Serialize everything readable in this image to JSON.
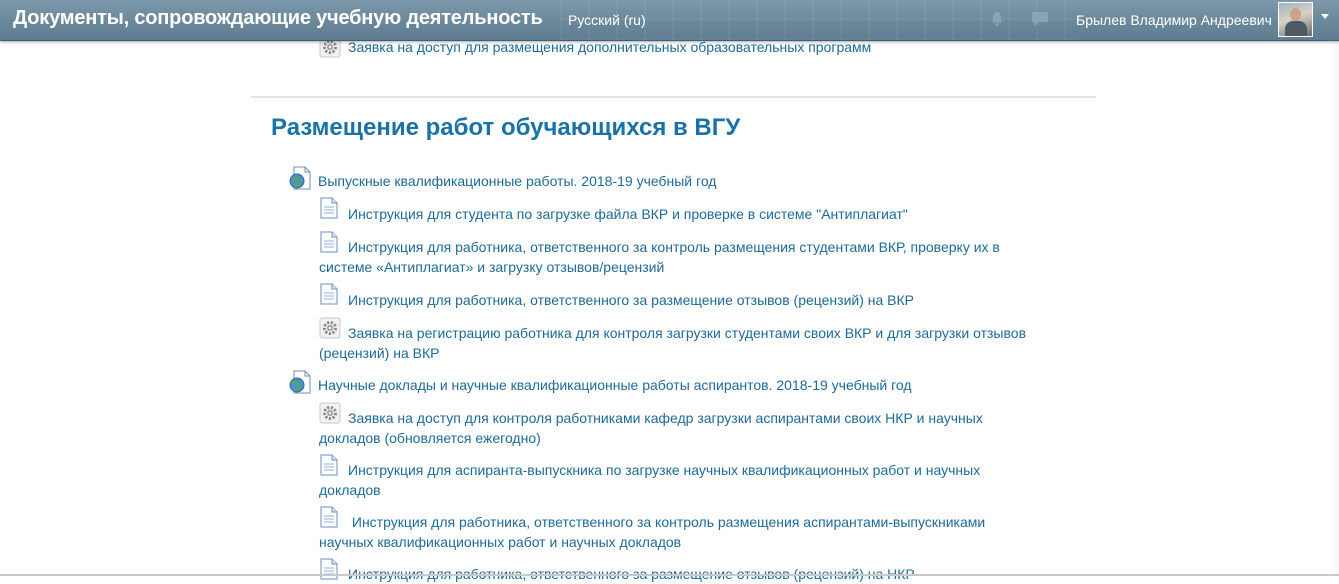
{
  "header": {
    "site_title": "Документы, сопровождающие учебную деятельность",
    "language": "Русский (ru)",
    "user_name": "Брылев Владимир Андреевич"
  },
  "top_item": {
    "label": "Заявка на доступ для размещения дополнительных образовательных программ"
  },
  "section": {
    "title": "Размещение работ обучающихся в ВГУ",
    "groups": [
      {
        "label": "Выпускные квалификационные работы. 2018-19 учебный год",
        "items": [
          {
            "icon": "document-icon",
            "line1": "Инструкция для студента по загрузке файла ВКР и проверке в системе \"Антиплагиат\"",
            "line2": ""
          },
          {
            "icon": "document-icon",
            "line1": "Инструкция для работника, ответственного за контроль размещения студентами ВКР, проверку их в",
            "line2": "системе «Антиплагиат» и загрузку отзывов/рецензий"
          },
          {
            "icon": "document-icon",
            "line1": "Инструкция для работника, ответственного за размещение отзывов (рецензий) на ВКР",
            "line2": ""
          },
          {
            "icon": "gear-icon",
            "line1": "Заявка на регистрацию работника для контроля загрузки студентами своих ВКР и для загрузки отзывов",
            "line2": "(рецензий) на ВКР"
          }
        ]
      },
      {
        "label": "Научные доклады и научные квалификационные работы аспирантов. 2018-19 учебный год",
        "items": [
          {
            "icon": "gear-icon",
            "line1": "Заявка на доступ для контроля работниками кафедр загрузки аспирантами своих НКР и научных",
            "line2": "докладов (обновляется ежегодно)"
          },
          {
            "icon": "document-icon",
            "line1": "Инструкция для аспиранта-выпускника по загрузке научных квалификационных работ и научных",
            "line2": "докладов"
          },
          {
            "icon": "document-icon",
            "line1": " Инструкция для работника, ответственного за контроль размещения аспирантами-выпускниками",
            "line2": "научных квалификационных работ и научных докладов"
          },
          {
            "icon": "document-icon",
            "line1": "Инструкция для работника, ответственного за размещение отзывов (рецензий) на НКР",
            "line2": ""
          }
        ]
      }
    ]
  },
  "colors": {
    "header_bg": "#6b889b",
    "link": "#1e6a98",
    "section_title": "#1a72a6"
  }
}
